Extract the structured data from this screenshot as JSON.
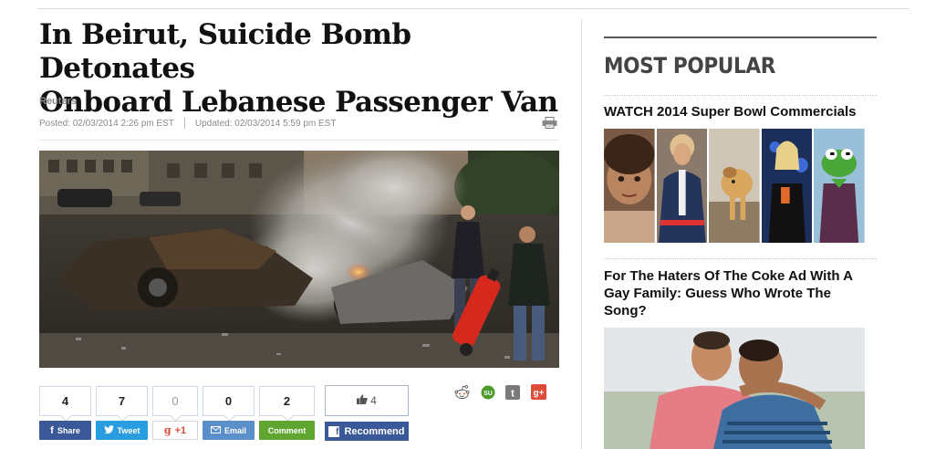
{
  "article": {
    "headline_line1": "In Beirut, Suicide Bomb Detonates",
    "headline_line2": "Onboard Lebanese Passenger Van",
    "source": "Reuters",
    "posted": "Posted: 02/03/2014 2:26 pm EST",
    "updated": "Updated: 02/03/2014 5:59 pm EST"
  },
  "share": {
    "facebook": {
      "count": "4",
      "label": "Share"
    },
    "twitter": {
      "count": "7",
      "label": "Tweet"
    },
    "gplus": {
      "count": "0",
      "label": "+1"
    },
    "email": {
      "count": "0",
      "label": "Email"
    },
    "comment": {
      "count": "2",
      "label": "Comment"
    },
    "recommend": {
      "count": "4",
      "label": "Recommend"
    }
  },
  "sidebar": {
    "title": "MOST POPULAR",
    "items": [
      {
        "title": "WATCH 2014 Super Bowl Commercials"
      },
      {
        "title_line1": "For The Haters Of The Coke Ad With A",
        "title_line2": "Gay Family: Guess Who Wrote The",
        "title_line3": "Song?"
      }
    ]
  },
  "icons": {
    "print": "printer-icon",
    "reddit": "reddit-icon",
    "stumbleupon": "stumbleupon-icon",
    "tumblr": "tumblr-icon",
    "googleplus": "google-plus-icon"
  },
  "colors": {
    "facebook": "#3b5998",
    "twitter": "#2a9ce0",
    "email": "#5b8fc9",
    "comment": "#5fa530",
    "gplus_red": "#dd4b39"
  }
}
